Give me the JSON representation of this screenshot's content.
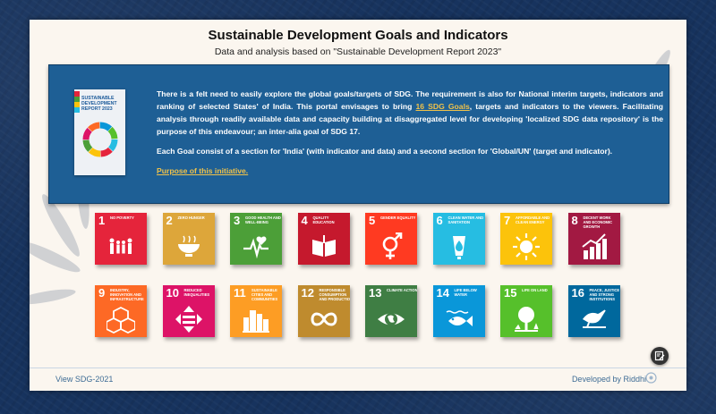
{
  "header": {
    "title": "Sustainable Development Goals and Indicators",
    "subtitle": "Data and analysis based on \"Sustainable Development Report 2023\""
  },
  "intro": {
    "cover_title": "SUSTAINABLE DEVELOPMENT REPORT 2023",
    "p1_a": "There is a felt need to easily explore the global goals/targets of SDG. The requirement is also for National interim targets, indicators and ranking of selected States' of India. This portal envisages to bring ",
    "p1_link": "16 SDG Goals",
    "p1_b": ", targets and indicators to the viewers. Facilitating analysis through readily available data and capacity building at disaggregated level for developing 'localized SDG data repository' is the purpose of this endeavour; an inter-alia goal of SDG 17.",
    "p2": "Each Goal consist of a section for 'India' (with indicator and data) and a second section for 'Global/UN' (target and indicator).",
    "purpose_link": "Purpose of this initiative."
  },
  "goals": [
    {
      "num": "1",
      "label": "NO POVERTY",
      "color": "#e5243b",
      "icon": "family-icon"
    },
    {
      "num": "2",
      "label": "ZERO HUNGER",
      "color": "#dda63a",
      "icon": "bowl-icon"
    },
    {
      "num": "3",
      "label": "GOOD HEALTH AND WELL-BEING",
      "color": "#4c9f38",
      "icon": "heartbeat-icon"
    },
    {
      "num": "4",
      "label": "QUALITY EDUCATION",
      "color": "#c5192d",
      "icon": "book-icon"
    },
    {
      "num": "5",
      "label": "GENDER EQUALITY",
      "color": "#ff3a21",
      "icon": "gender-icon"
    },
    {
      "num": "6",
      "label": "CLEAN WATER AND SANITATION",
      "color": "#26bde2",
      "icon": "water-icon"
    },
    {
      "num": "7",
      "label": "AFFORDABLE AND CLEAN ENERGY",
      "color": "#fcc30b",
      "icon": "sun-icon"
    },
    {
      "num": "8",
      "label": "DECENT WORK AND ECONOMIC GROWTH",
      "color": "#a21942",
      "icon": "growth-chart-icon"
    },
    {
      "num": "9",
      "label": "INDUSTRY, INNOVATION AND INFRASTRUCTURE",
      "color": "#fd6925",
      "icon": "cubes-icon"
    },
    {
      "num": "10",
      "label": "REDUCED INEQUALITIES",
      "color": "#dd1367",
      "icon": "equality-arrows-icon"
    },
    {
      "num": "11",
      "label": "SUSTAINABLE CITIES AND COMMUNITIES",
      "color": "#fd9d24",
      "icon": "city-icon"
    },
    {
      "num": "12",
      "label": "RESPONSIBLE CONSUMPTION AND PRODUCTION",
      "color": "#bf8b2e",
      "icon": "infinity-icon"
    },
    {
      "num": "13",
      "label": "CLIMATE ACTION",
      "color": "#3f7e44",
      "icon": "eye-globe-icon"
    },
    {
      "num": "14",
      "label": "LIFE BELOW WATER",
      "color": "#0a97d9",
      "icon": "fish-icon"
    },
    {
      "num": "15",
      "label": "LIFE ON LAND",
      "color": "#56c02b",
      "icon": "tree-icon"
    },
    {
      "num": "16",
      "label": "PEACE, JUSTICE AND STRONG INSTITUTIONS",
      "color": "#00689d",
      "icon": "dove-icon"
    }
  ],
  "footer": {
    "left_link": "View SDG-2021",
    "right_text": "Developed by Riddhi"
  }
}
